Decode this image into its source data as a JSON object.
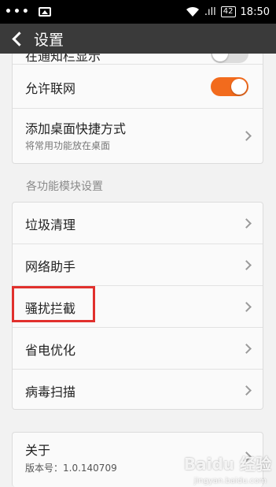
{
  "status_bar": {
    "dots": "•••",
    "signal": ".ıll",
    "battery": "42",
    "time": "18:50"
  },
  "header": {
    "title": "设置"
  },
  "top_card": {
    "rows": [
      {
        "label": "在通知栏显示",
        "toggle": false
      },
      {
        "label": "允许联网",
        "toggle": true
      },
      {
        "label": "添加桌面快捷方式",
        "sub": "将常用功能放在桌面"
      }
    ]
  },
  "section": {
    "label": "各功能模块设置"
  },
  "modules": [
    {
      "label": "垃圾清理"
    },
    {
      "label": "网络助手"
    },
    {
      "label": "骚扰拦截"
    },
    {
      "label": "省电优化"
    },
    {
      "label": "病毒扫描"
    }
  ],
  "about": {
    "label": "关于",
    "version": "版本号：1.0.140709"
  },
  "watermark": {
    "logo": "Baidu 经验",
    "site": "jingyan.baidu.com"
  }
}
